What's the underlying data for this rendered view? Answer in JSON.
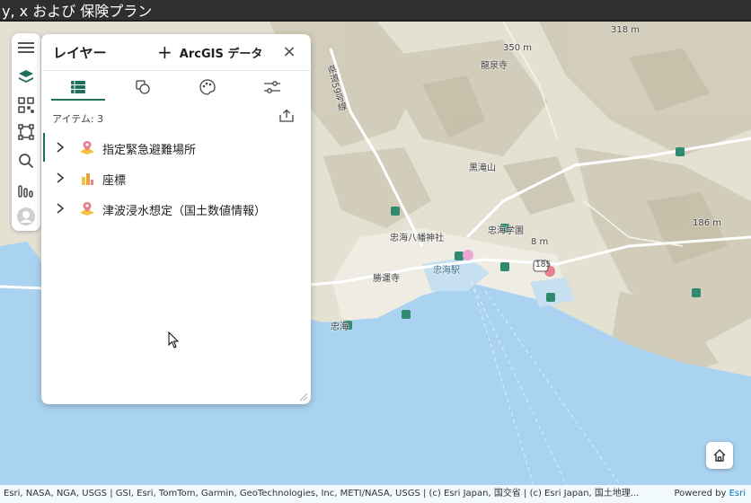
{
  "window": {
    "title": "y, x および 保険プラン"
  },
  "toolbar": {
    "items": [
      {
        "icon": "hamburger-menu-icon"
      },
      {
        "icon": "layers-icon"
      },
      {
        "icon": "qr-code-icon"
      },
      {
        "icon": "select-area-icon"
      },
      {
        "icon": "search-icon"
      },
      {
        "icon": "chart-icon"
      },
      {
        "icon": "user-avatar-icon"
      }
    ]
  },
  "panel": {
    "title": "レイヤー",
    "add_data_label": "ArcGIS データ",
    "close_symbol": "×",
    "tabs": [
      {
        "name": "layer-list",
        "icon": "table-list-icon",
        "active": true
      },
      {
        "name": "basemap",
        "icon": "shapes-icon",
        "active": false
      },
      {
        "name": "style",
        "icon": "palette-icon",
        "active": false
      },
      {
        "name": "settings",
        "icon": "sliders-icon",
        "active": false
      }
    ],
    "items_count": "アイテム: 3",
    "layers": [
      {
        "label": "指定緊急避難場所",
        "icon": "point-layer-icon",
        "selected": true
      },
      {
        "label": "座標",
        "icon": "chart-layer-icon",
        "selected": false
      },
      {
        "label": "津波浸水想定（国土数値情報）",
        "icon": "point-layer-icon",
        "selected": false
      }
    ]
  },
  "map": {
    "labels": {
      "elev_350": "350 m",
      "elev_318": "318 m",
      "temple_ryusen": "龍泉寺",
      "route_59": "県道59号線",
      "mt_kurotaki": "黒滝山",
      "shrine": "忠海八幡神社",
      "school": "忠海学園",
      "elev_8": "8 m",
      "elev_186": "186 m",
      "temple_shoun": "勝運寺",
      "station": "忠海駅",
      "route_185": "185",
      "town": "忠海"
    },
    "colors": {
      "sea": "#aad3f1",
      "land": "#e9e6dc",
      "marker": "#e97f8f",
      "accent": "#1f6f5c"
    }
  },
  "attribution": {
    "text": "Esri, NASA, NGA, USGS | GSI, Esri, TomTom, Garmin, GeoTechnologies, Inc, METI/NASA, USGS | (c) Esri Japan, 国交省 | (c) Esri Japan, 国土地理...",
    "powered_prefix": "Powered by ",
    "powered_brand": "Esri"
  }
}
